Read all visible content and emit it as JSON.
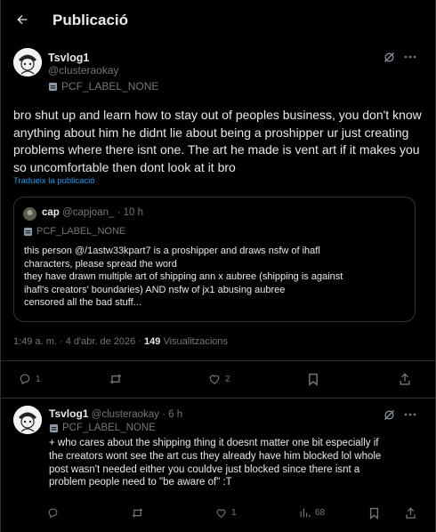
{
  "header": {
    "title": "Publicació"
  },
  "post": {
    "display_name": "Tsvlog1",
    "handle": "@clusteraokay",
    "label": "PCF_LABEL_NONE",
    "text": "bro shut up and learn how to stay out of peoples business, you don't know anything about him he didnt lie about being a proshipper ur just creating problems where there isnt one. The art he made is vent art if it makes you so uncomfortable then dont look at it bro",
    "translate_link": "Tradueix la publicació",
    "quote": {
      "display_name": "cap",
      "handle": "@capjoan_",
      "separator": "·",
      "time": "10 h",
      "label": "PCF_LABEL_NONE",
      "lines": [
        "this person @/1astw33kpart7 is a proshipper and draws nsfw of ihafl",
        "characters, please spread the word",
        "they have drawn multiple art of shipping ann x aubree (shipping is against",
        "ihafl's creators' boundaries) AND nsfw of jx1 abusing aubree",
        "censored all the bad stuff..."
      ]
    },
    "timestamp": "1:49 a. m. · 4 d'abr. de 2026 ·",
    "views_count": "149",
    "views_label": "Visualitzacions",
    "actions": {
      "replies": "1",
      "retweets": "",
      "likes": "2"
    }
  },
  "reply": {
    "display_name": "Tsvlog1",
    "handle": "@clusteraokay",
    "separator": "·",
    "time": "6 h",
    "label": "PCF_LABEL_NONE",
    "lines": [
      "+ who cares about the shipping thing it doesnt matter one bit especially if",
      "the creators wont see the art cus they already have him blocked lol whole",
      "post wasn't needed either you couldve just blocked since there isnt a",
      "problem people need to \"be aware of\" :T"
    ],
    "actions": {
      "replies": "",
      "retweets": "",
      "likes": "1",
      "views": "68"
    }
  },
  "colors": {
    "background": "#000000",
    "text": "#e7e9ea",
    "muted": "#71767b",
    "link": "#1d9bf0",
    "border": "#2f3336"
  }
}
